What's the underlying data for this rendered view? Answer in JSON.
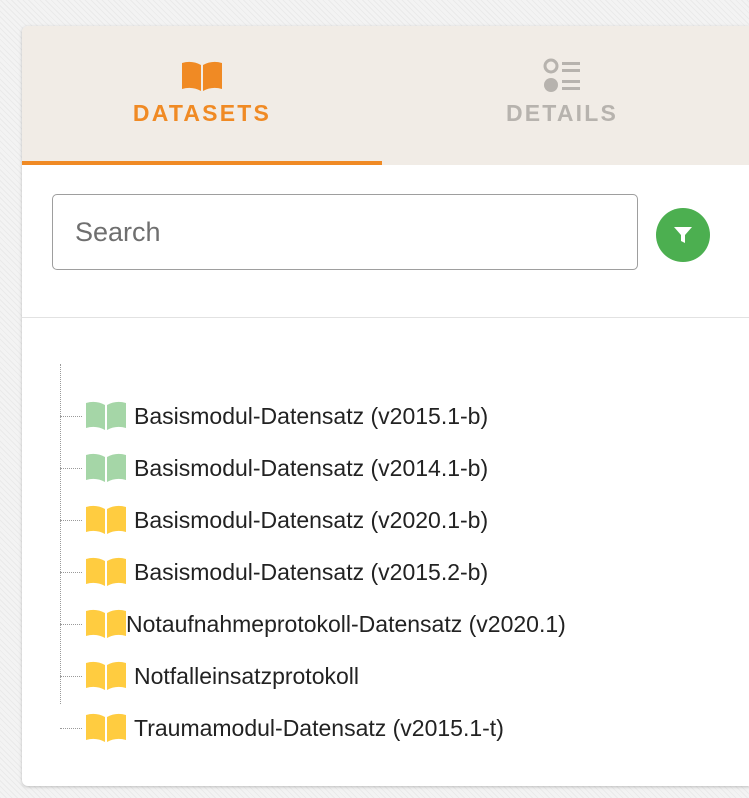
{
  "tabs": [
    {
      "label": "DATASETS",
      "icon": "open-book-icon",
      "active": true
    },
    {
      "label": "DETAILS",
      "icon": "list-details-icon",
      "active": false
    }
  ],
  "search": {
    "placeholder": "Search",
    "value": ""
  },
  "filter": {
    "icon": "filter-icon"
  },
  "colors": {
    "accent": "#f08a24",
    "tab_background": "#f1ece6",
    "tab_inactive": "#b7b3ae",
    "filter_button": "#4caf50",
    "book_green": "#a5d6a7",
    "book_yellow": "#ffcc40"
  },
  "tree": {
    "items": [
      {
        "name": "Basismodul-Datensatz (v2015.1-b)",
        "icon": "green-book-icon"
      },
      {
        "name": "Basismodul-Datensatz (v2014.1-b)",
        "icon": "green-book-icon"
      },
      {
        "name": "Basismodul-Datensatz (v2020.1-b)",
        "icon": "yellow-book-icon"
      },
      {
        "name": "Basismodul-Datensatz (v2015.2-b)",
        "icon": "yellow-book-icon"
      },
      {
        "name": "Notaufnahmeprotokoll-Datensatz (v2020.1)",
        "icon": "yellow-book-icon"
      },
      {
        "name": "Notfalleinsatzprotokoll",
        "icon": "yellow-book-icon"
      },
      {
        "name": "Traumamodul-Datensatz (v2015.1-t)",
        "icon": "yellow-book-icon"
      }
    ]
  }
}
